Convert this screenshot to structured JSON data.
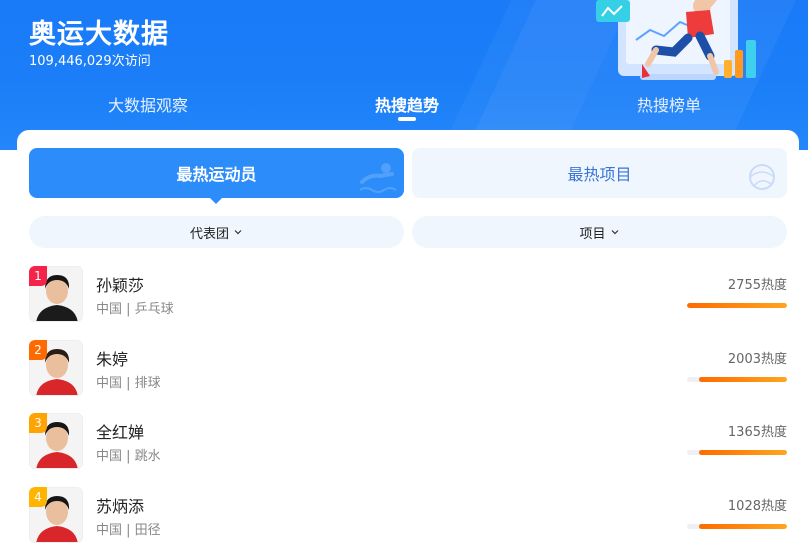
{
  "header": {
    "title": "奥运大数据",
    "visit_count": "109,446,029次访问"
  },
  "nav_tabs": [
    {
      "label": "大数据观察",
      "active": false
    },
    {
      "label": "热搜趋势",
      "active": true
    },
    {
      "label": "热搜榜单",
      "active": false
    }
  ],
  "segments": {
    "active_label": "最热运动员",
    "inactive_label": "最热项目"
  },
  "filters": {
    "delegation_label": "代表团",
    "event_label": "项目"
  },
  "athletes": [
    {
      "rank": "1",
      "name": "孙颖莎",
      "country": "中国",
      "sport": "乒乓球",
      "heat": "2755热度",
      "heat_value": 2755,
      "rank_color": "#f5234a",
      "shirt": "#1b1b1b",
      "hair": "#161616"
    },
    {
      "rank": "2",
      "name": "朱婷",
      "country": "中国",
      "sport": "排球",
      "heat": "2003热度",
      "heat_value": 2003,
      "rank_color": "#ff6a00",
      "shirt": "#d8262b",
      "hair": "#2a1c16"
    },
    {
      "rank": "3",
      "name": "全红婵",
      "country": "中国",
      "sport": "跳水",
      "heat": "1365热度",
      "heat_value": 1365,
      "rank_color": "#ffa300",
      "shirt": "#d8262b",
      "hair": "#161616"
    },
    {
      "rank": "4",
      "name": "苏炳添",
      "country": "中国",
      "sport": "田径",
      "heat": "1028热度",
      "heat_value": 1028,
      "rank_color": "#ffb400",
      "shirt": "#d8262b",
      "hair": "#161616"
    }
  ],
  "colors": {
    "header_blue": "#1a7af8",
    "accent_blue": "#2b8cfa",
    "heat_bar_start": "#ff6a00",
    "heat_bar_end": "#ffa51e"
  }
}
